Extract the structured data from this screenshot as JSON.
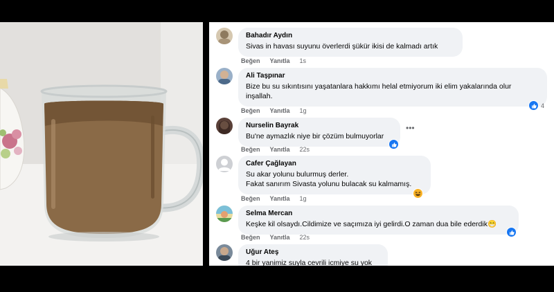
{
  "photo": {
    "subject": "glass-mug-of-muddy-water"
  },
  "actions": {
    "like_label": "Beğen",
    "reply_label": "Yanıtla"
  },
  "comments": [
    {
      "name": "Bahadır Aydın",
      "lines": [
        "Sivas in havası suyunu överlerdi şükür ikisi de kalmadı artık"
      ],
      "time": "1s",
      "reactions": null
    },
    {
      "name": "Ali Taşpınar",
      "lines": [
        "Bize bu su sıkıntısını yaşatanlara hakkımı helal etmiyorum iki elim yakalarında olur",
        "inşallah."
      ],
      "time": "1g",
      "reactions": {
        "type": "like",
        "count": "4"
      }
    },
    {
      "name": "Nurselin Bayrak",
      "lines": [
        "Bu'ne aymazlık niye bir çözüm bulmuyorlar"
      ],
      "time": "22s",
      "reactions": {
        "type": "like",
        "count": ""
      }
    },
    {
      "name": "Cafer Çağlayan",
      "lines": [
        "Su akar yolunu bulurmuş derler.",
        "Fakat sanırım Sivasta yolunu bulacak su kalmamış."
      ],
      "time": "1g",
      "reactions": {
        "type": "haha",
        "count": ""
      }
    },
    {
      "name": "Selma Mercan",
      "lines": [
        "Keşke kil olsaydı.Cildimize ve saçımıza iyi gelirdi.O zaman dua bile ederdik😁"
      ],
      "time": "22s",
      "reactions": {
        "type": "like",
        "count": ""
      }
    },
    {
      "name": "Uğur Ateş",
      "lines": [
        "4 bir yanimiz suyla cevrili icmiye su yok"
      ],
      "time": "",
      "reactions": null
    }
  ],
  "colors": {
    "bubble": "#f0f2f5",
    "like": "#1877f2",
    "haha": "#f7b125",
    "meta": "#65676b"
  },
  "icons": [
    "more-options-icon",
    "like-reaction-icon",
    "haha-reaction-icon"
  ]
}
